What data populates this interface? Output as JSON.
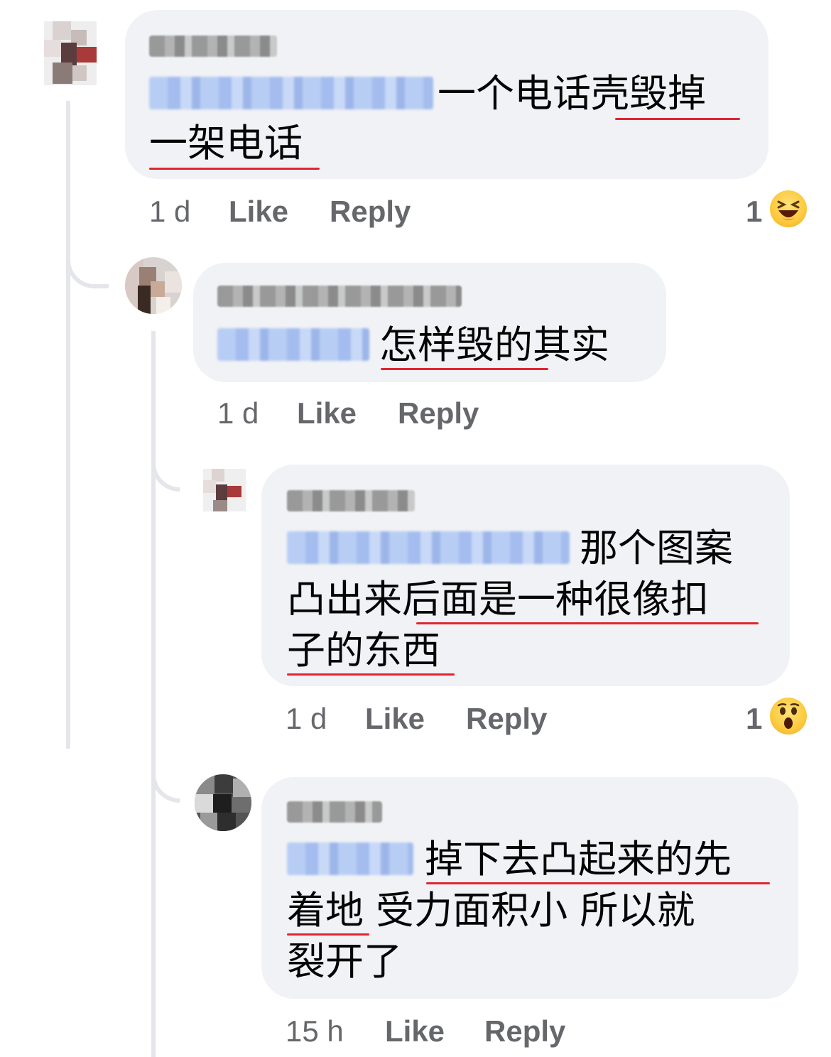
{
  "comments": [
    {
      "time": "1 d",
      "like_label": "Like",
      "reply_label": "Reply",
      "text_line1": "一个电话壳毁掉",
      "text_line2": "一架电话",
      "reaction_count": "1",
      "reaction_icon": "laughing-emoji"
    },
    {
      "time": "1 d",
      "like_label": "Like",
      "reply_label": "Reply",
      "text_line1": "怎样毁的其实"
    },
    {
      "time": "1 d",
      "like_label": "Like",
      "reply_label": "Reply",
      "text_line1": "那个图案",
      "text_line2": "凸出来后面是一种很像扣",
      "text_line3": "子的东西",
      "reaction_count": "1",
      "reaction_icon": "wow-emoji"
    },
    {
      "time": "15 h",
      "like_label": "Like",
      "reply_label": "Reply",
      "text_line1": "掉下去凸起来的先",
      "text_line2": "着地 受力面积小 所以就",
      "text_line3": "裂开了"
    }
  ],
  "colors": {
    "bubble": "#f0f2f5",
    "meta_text": "#65676b",
    "underline": "#e0252f",
    "mention_blur": "#b8cdf4"
  }
}
